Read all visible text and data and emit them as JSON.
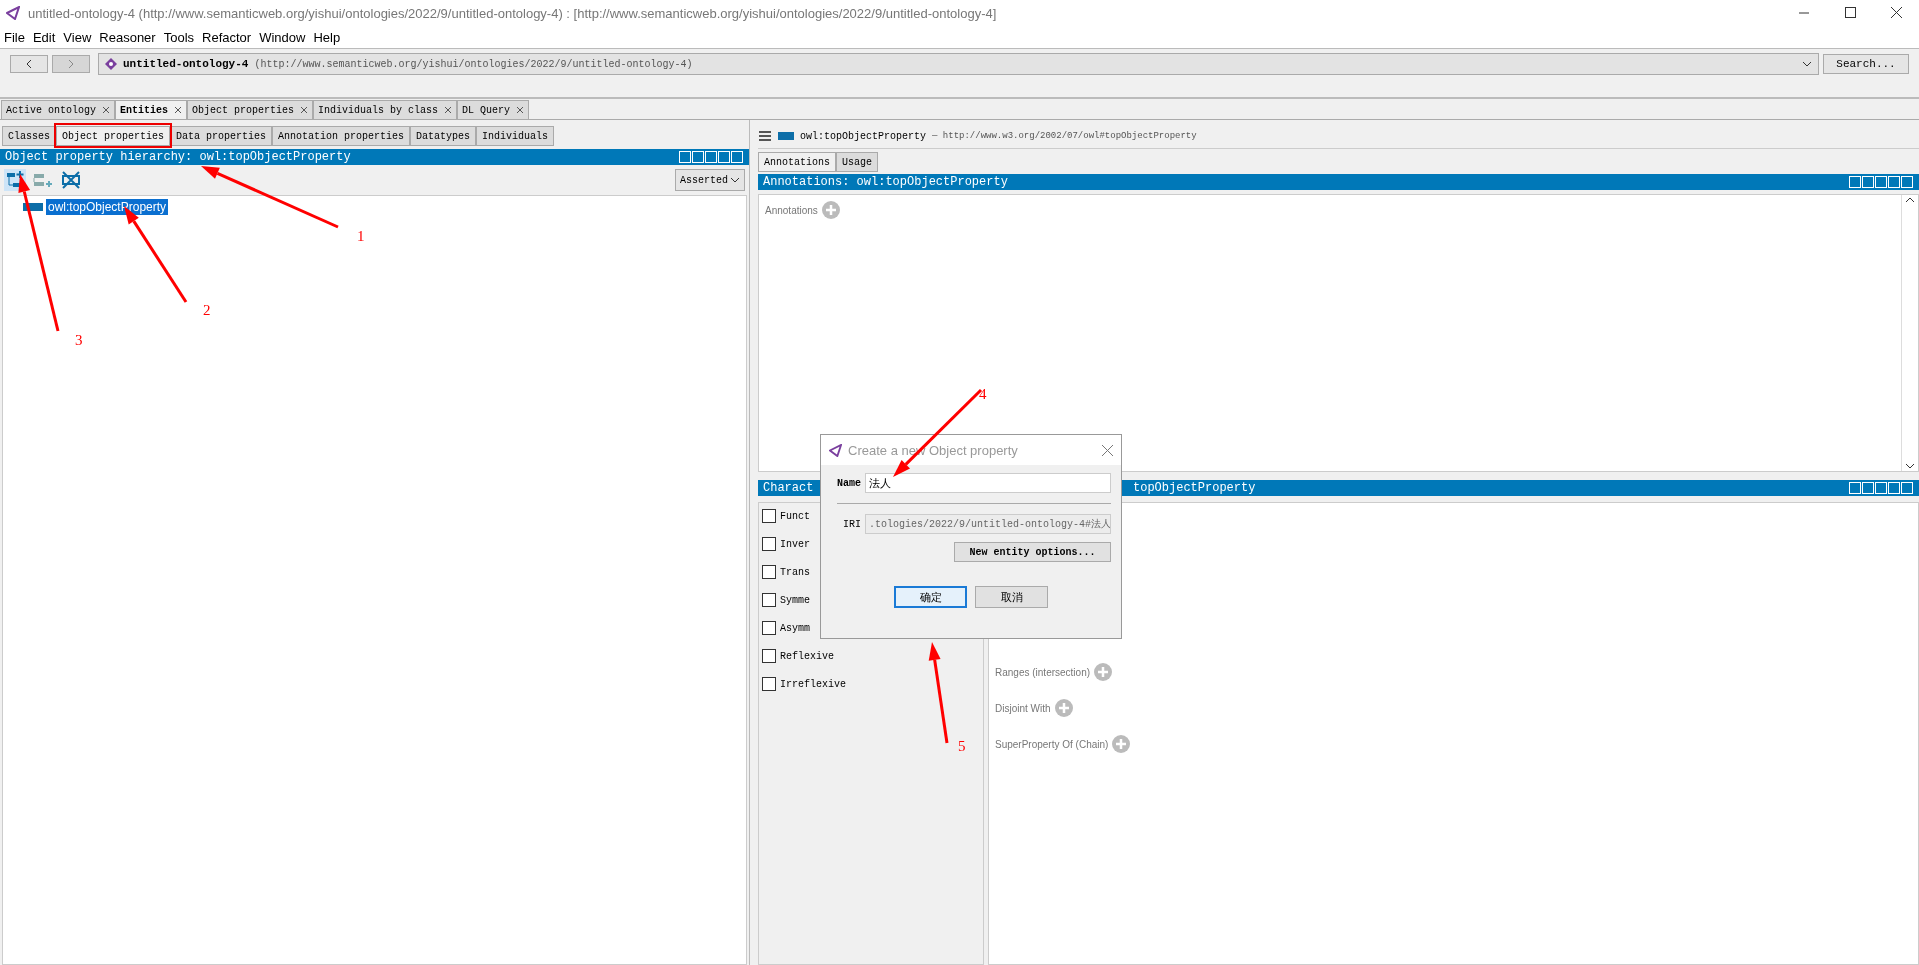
{
  "window": {
    "title": "untitled-ontology-4 (http://www.semanticweb.org/yishui/ontologies/2022/9/untitled-ontology-4)  : [http://www.semanticweb.org/yishui/ontologies/2022/9/untitled-ontology-4]"
  },
  "menu": [
    "File",
    "Edit",
    "View",
    "Reasoner",
    "Tools",
    "Refactor",
    "Window",
    "Help"
  ],
  "navigation": {
    "ontology_name": "untitled-ontology-4",
    "ontology_iri": "(http://www.semanticweb.org/yishui/ontologies/2022/9/untitled-ontology-4)",
    "search_button": "Search..."
  },
  "tabs": [
    {
      "label": "Active ontology",
      "selected": false
    },
    {
      "label": "Entities",
      "selected": true
    },
    {
      "label": "Object properties",
      "selected": false
    },
    {
      "label": "Individuals by class",
      "selected": false
    },
    {
      "label": "DL Query",
      "selected": false
    }
  ],
  "left_panel": {
    "tabs": [
      {
        "label": "Classes",
        "selected": false
      },
      {
        "label": "Object properties",
        "selected": true
      },
      {
        "label": "Data properties",
        "selected": false
      },
      {
        "label": "Annotation properties",
        "selected": false
      },
      {
        "label": "Datatypes",
        "selected": false
      },
      {
        "label": "Individuals",
        "selected": false
      }
    ],
    "header": "Object property hierarchy: owl:topObjectProperty",
    "view_mode": "Asserted",
    "tree": [
      {
        "label": "owl:topObjectProperty",
        "selected": true
      }
    ]
  },
  "right_panel": {
    "entity": "owl:topObjectProperty",
    "entity_iri": "— http://www.w3.org/2002/07/owl#topObjectProperty",
    "tabs": [
      {
        "label": "Annotations",
        "selected": true
      },
      {
        "label": "Usage",
        "selected": false
      }
    ],
    "annotations_header": "Annotations: owl:topObjectProperty",
    "annotations_label": "Annotations",
    "characteristics_header": "Charact",
    "characteristics": [
      {
        "label": "Funct",
        "checked": false
      },
      {
        "label": "Inver",
        "checked": false
      },
      {
        "label": "Trans",
        "checked": false
      },
      {
        "label": "Symme",
        "checked": false
      },
      {
        "label": "Asymm",
        "checked": false
      },
      {
        "label": "Reflexive",
        "checked": false
      },
      {
        "label": "Irreflexive",
        "checked": false
      }
    ],
    "description_header": "topObjectProperty",
    "description_sections": [
      "Ranges (intersection)",
      "Disjoint With",
      "SuperProperty Of (Chain)"
    ]
  },
  "dialog": {
    "title": "Create a new Object property",
    "name_label": "Name",
    "name_value": "法人",
    "iri_label": "IRI",
    "iri_value": ".tologies/2022/9/untitled-ontology-4#法人",
    "options_button": "New entity options...",
    "buttons": [
      {
        "label": "确定",
        "default": true
      },
      {
        "label": "取消",
        "default": false
      }
    ]
  },
  "callouts": [
    "1",
    "2",
    "3",
    "4",
    "5"
  ]
}
